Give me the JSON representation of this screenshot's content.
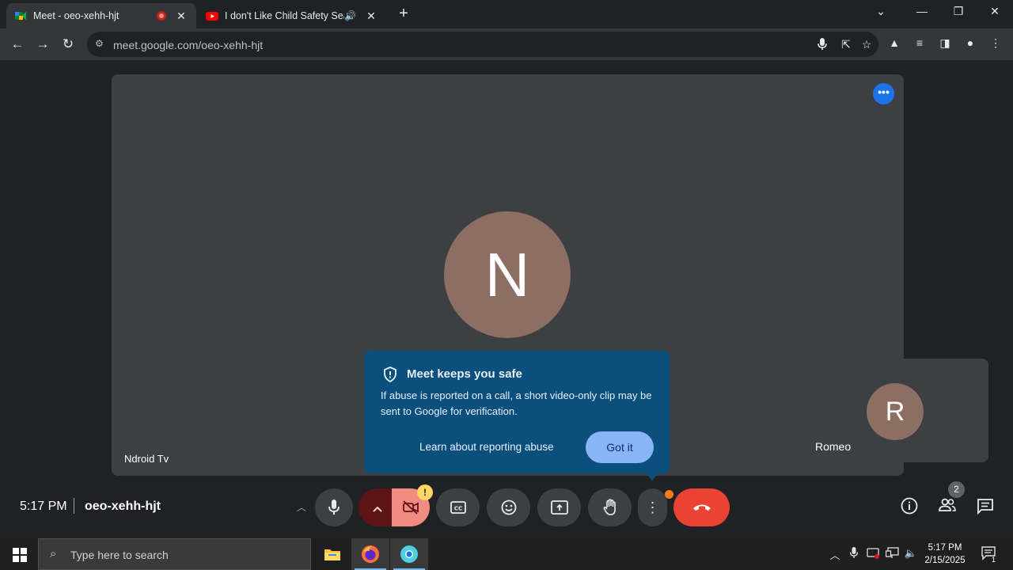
{
  "browser": {
    "tabs": [
      {
        "title": "Meet - oeo-xehh-hjt",
        "favicon": "google-meet-icon",
        "active": true
      },
      {
        "title": "I don't Like Child Safety Sea",
        "favicon": "youtube-icon",
        "active": false
      }
    ],
    "url": "meet.google.com/oeo-xehh-hjt"
  },
  "meet": {
    "main_participant": {
      "initial": "N",
      "name": "Ndroid Tv"
    },
    "side_participant": {
      "initial": "R",
      "name": "Romeo"
    },
    "popup": {
      "title": "Meet keeps you safe",
      "body": "If abuse is reported on a call, a short video-only clip may be sent to Google for verification.",
      "link": "Learn about reporting abuse",
      "button": "Got it"
    },
    "time": "5:17 PM",
    "meeting_code": "oeo-xehh-hjt",
    "people_count": "2",
    "colors": {
      "end_call": "#ea4335",
      "camera_off": "#f28b82",
      "popup_bg": "#0b4f7c",
      "accent": "#8ab4f8"
    }
  },
  "taskbar": {
    "search_placeholder": "Type here to search",
    "clock_time": "5:17 PM",
    "clock_date": "2/15/2025",
    "notification_count": "1"
  }
}
